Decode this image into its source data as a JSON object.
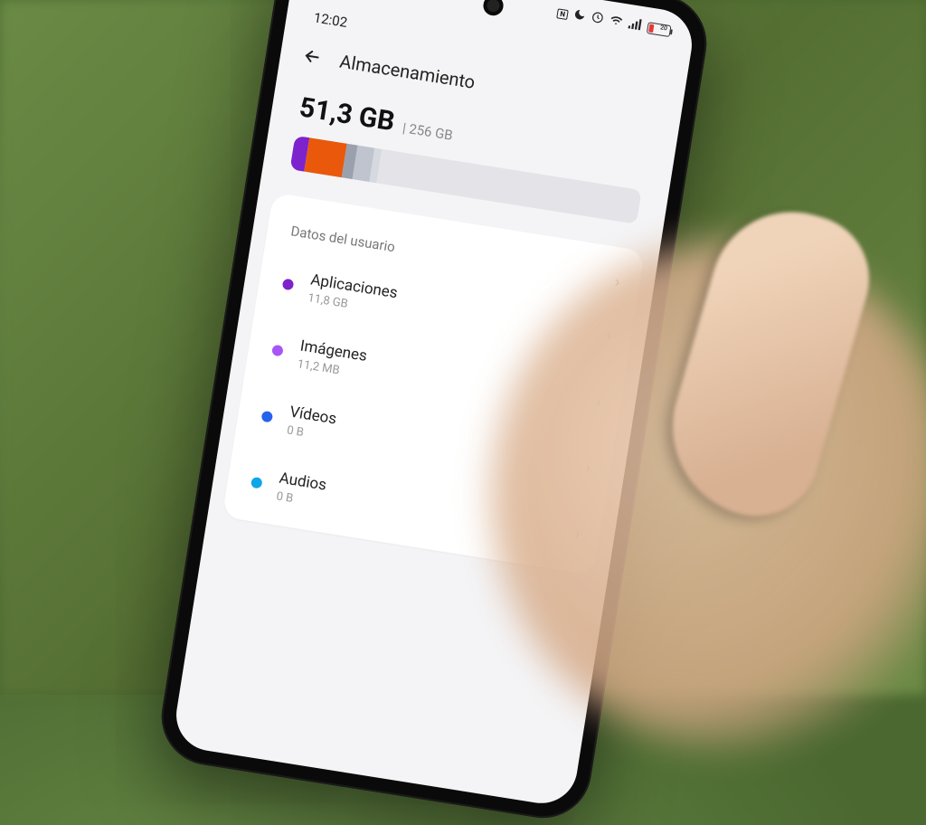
{
  "statusbar": {
    "clock": "12:02",
    "battery_pct": "20"
  },
  "header": {
    "title": "Almacenamiento"
  },
  "storage": {
    "used": "51,3 GB",
    "total_prefix": "| 256 GB"
  },
  "section_header": "Datos del usuario",
  "categories": [
    {
      "label": "Aplicaciones",
      "size": "11,8 GB",
      "color": "purple"
    },
    {
      "label": "Imágenes",
      "size": "11,2 MB",
      "color": "lav"
    },
    {
      "label": "Vídeos",
      "size": "0 B",
      "color": "blue"
    },
    {
      "label": "Audios",
      "size": "0 B",
      "color": "cyan"
    }
  ]
}
